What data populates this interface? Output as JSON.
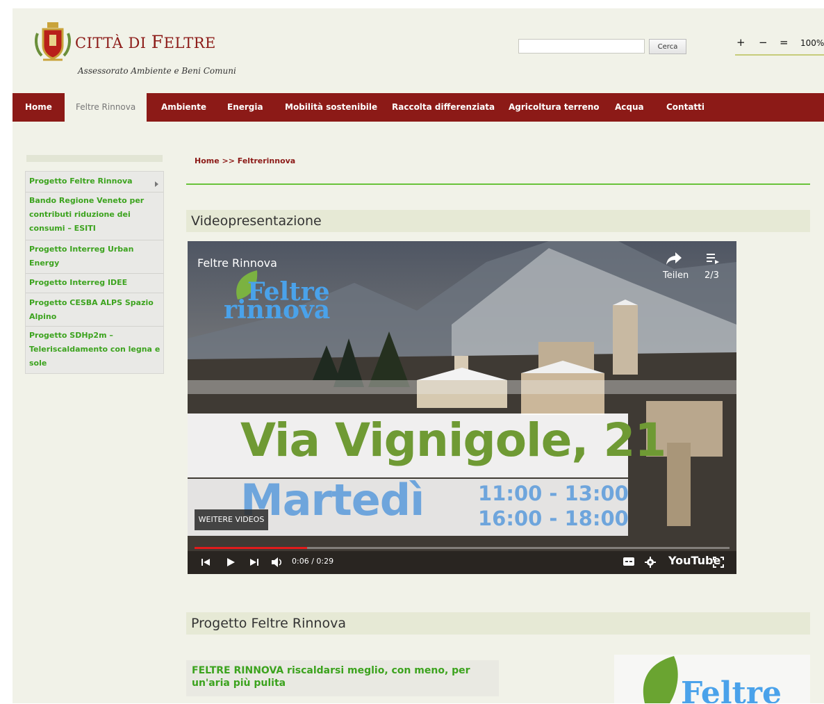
{
  "header": {
    "title_prefix": "CITTÀ DI ",
    "title_initial": "F",
    "title_rest": "ELTRE",
    "subtitle": "Assessorato Ambiente e Beni Comuni",
    "search_placeholder": "",
    "search_button": "Cerca",
    "zoom_in": "+",
    "zoom_out": "−",
    "zoom_reset": "=",
    "zoom_level": "100%"
  },
  "nav": {
    "items": [
      {
        "label": "Home"
      },
      {
        "label": "Feltre Rinnova",
        "active": true
      },
      {
        "label": "Ambiente"
      },
      {
        "label": "Energia"
      },
      {
        "label": "Mobilità sostenibile"
      },
      {
        "label": "Raccolta differenziata"
      },
      {
        "label": "Agricoltura terreno"
      },
      {
        "label": "Acqua"
      },
      {
        "label": "Contatti"
      }
    ]
  },
  "sidebar": {
    "items": [
      {
        "label": "Progetto Feltre Rinnova"
      },
      {
        "label": "Bando Regione Veneto per contributi riduzione dei consumi – ESITI"
      },
      {
        "label": "Progetto Interreg Urban Energy"
      },
      {
        "label": "Progetto Interreg IDEE"
      },
      {
        "label": "Progetto CESBA ALPS Spazio Alpino"
      },
      {
        "label": "Progetto SDHp2m – Teleriscaldamento con legna e sole"
      }
    ]
  },
  "breadcrumb": {
    "home": "Home",
    "separator": " >> ",
    "current": "Feltrerinnova"
  },
  "sections": {
    "video_title": "Videopresentazione",
    "project_title": "Progetto Feltre Rinnova"
  },
  "video": {
    "channel_title": "Feltre Rinnova",
    "brand_top": "Feltre",
    "brand_bottom": "rinnova",
    "share_label": "Teilen",
    "playlist_position": "2/3",
    "headline_street": "Via Vignigole, 21",
    "headline_day": "Martedì",
    "hours_1": "11:00 - 13:00",
    "hours_2": "16:00 - 18:00",
    "more_videos": "WEITERE VIDEOS",
    "timecode": "0:06 / 0:29",
    "progress": 0.21,
    "youtube_label": "YouTube"
  },
  "project": {
    "heading": "FELTRE RINNOVA riscaldarsi meglio, con meno, per un'aria più pulita",
    "logo_text": "Feltre"
  },
  "colors": {
    "brand_red": "#8c1a17",
    "link_green": "#3ca31e",
    "page_bg": "#f1f2e8",
    "accent_line": "#68c33a"
  }
}
